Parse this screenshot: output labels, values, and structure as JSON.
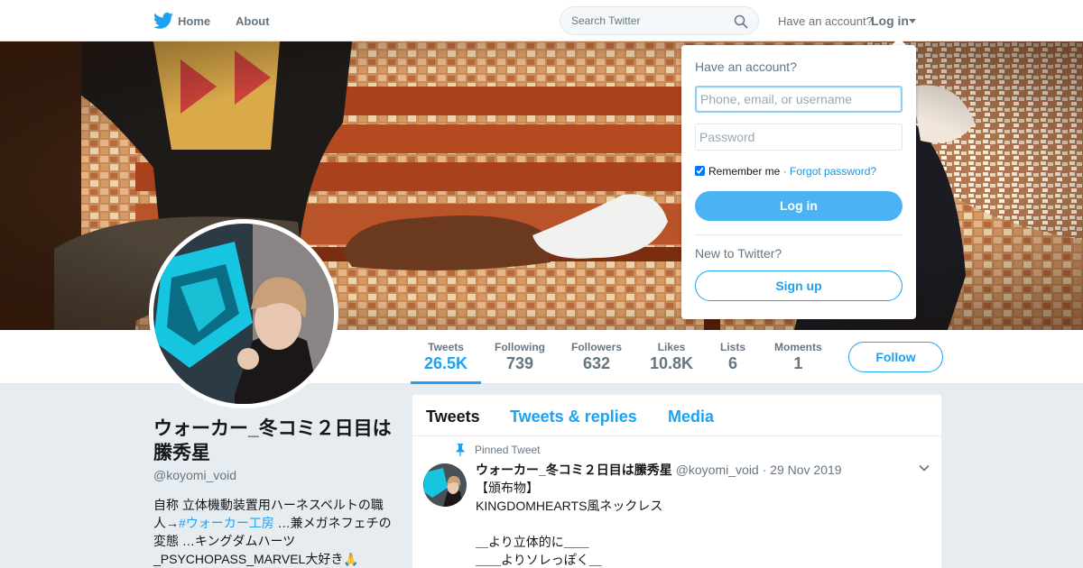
{
  "nav": {
    "logo_icon": "twitter-bird-icon",
    "home_label": "Home",
    "about_label": "About",
    "search_placeholder": "Search Twitter",
    "have_account": "Have an account?",
    "login_label": "Log in"
  },
  "profile_nav": {
    "stats": [
      {
        "label": "Tweets",
        "value": "26.5K",
        "active": true
      },
      {
        "label": "Following",
        "value": "739"
      },
      {
        "label": "Followers",
        "value": "632"
      },
      {
        "label": "Likes",
        "value": "10.8K"
      },
      {
        "label": "Lists",
        "value": "6"
      },
      {
        "label": "Moments",
        "value": "1"
      }
    ],
    "follow_label": "Follow"
  },
  "profile": {
    "display_name": "ウォーカー_冬コミ２日目は縢秀星",
    "handle": "@koyomi_void",
    "bio_part1": "自称 立体機動装置用ハーネスベルトの職人→",
    "bio_hashtag": "#ウォーカー工房",
    "bio_part2": " …兼メガネフェチの変態 …キングダムハーツ_PSYCHOPASS_MARVEL大好き🙏"
  },
  "timeline": {
    "tabs": [
      "Tweets",
      "Tweets & replies",
      "Media"
    ],
    "pinned_label": "Pinned Tweet",
    "tweet": {
      "name": "ウォーカー_冬コミ２日目は縢秀星",
      "handle": "@koyomi_void",
      "date": "29 Nov 2019",
      "text": "【頒布物】\nKINGDOMHEARTS風ネックレス\n\n＿より立体的に＿＿\n＿＿よりソレっぽく＿"
    }
  },
  "login_dropdown": {
    "title": "Have an account?",
    "username_placeholder": "Phone, email, or username",
    "password_placeholder": "Password",
    "remember_label": "Remember me",
    "separator": " · ",
    "forgot_label": "Forgot password?",
    "login_button": "Log in",
    "new_to_twitter": "New to Twitter?",
    "signup_button": "Sign up"
  },
  "colors": {
    "accent": "#1da1f2",
    "background": "#e6ecf0",
    "muted_text": "#657786"
  }
}
